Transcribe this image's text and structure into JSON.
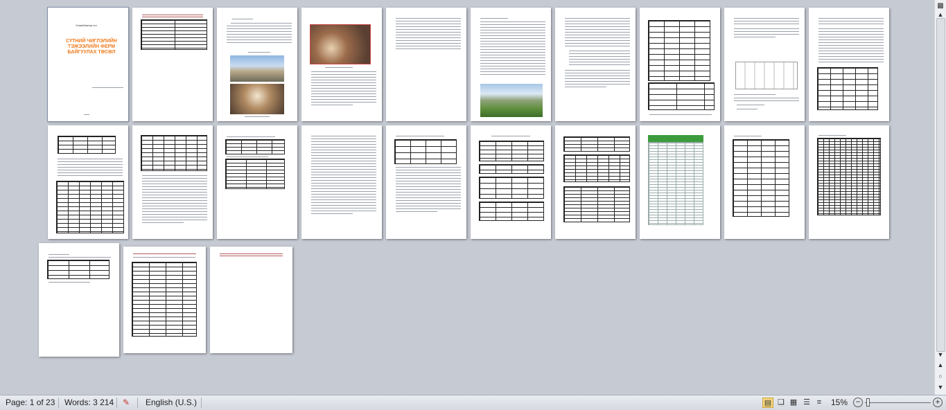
{
  "document": {
    "cover_header": "Улаанбаатар хот",
    "cover_title": "СҮТНИЙ ЧИГЛЭЛИЙН ТЭЖЭЭЛИЙН ФЕРМ БАЙГУУЛАХ ТӨСӨЛ"
  },
  "status_bar": {
    "page_info": "Page: 1 of 23",
    "words": "Words: 3 214",
    "language": "English (U.S.)",
    "zoom": "15%",
    "zoom_out": "−",
    "zoom_in": "+"
  },
  "view_buttons": [
    {
      "name": "view-print-layout-button",
      "glyph": "▤"
    },
    {
      "name": "view-full-screen-reading-button",
      "glyph": "📖"
    },
    {
      "name": "view-web-layout-button",
      "glyph": "▦"
    },
    {
      "name": "view-outline-button",
      "glyph": "☰"
    },
    {
      "name": "view-draft-button",
      "glyph": "≡"
    }
  ],
  "scrollbar": {
    "up": "▲",
    "down": "▼",
    "prev": "▲",
    "next": "▼",
    "browse": "○"
  },
  "colors": {
    "accent": "#f07a1a",
    "canvas": "#c6cad3"
  }
}
